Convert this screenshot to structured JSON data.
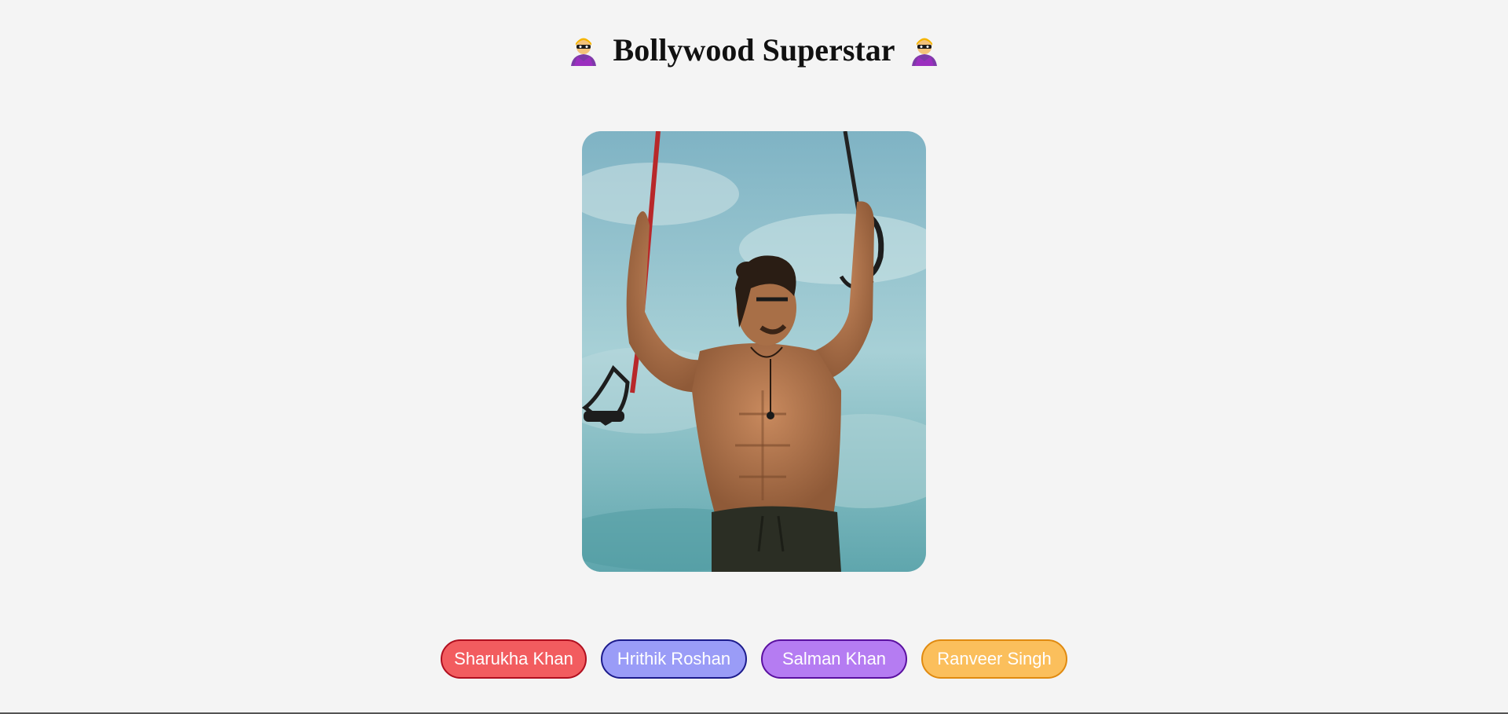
{
  "header": {
    "title": "Bollywood Superstar",
    "icon_left": "superhero-icon",
    "icon_right": "superhero-icon"
  },
  "photo": {
    "subject": "shirtless-man-with-resistance-bands",
    "sky_color": "#8fc3cc",
    "shorts_color": "#2b2e24",
    "band_color": "#b8282a"
  },
  "buttons": [
    {
      "label": "Sharukha Khan",
      "bg": "#f25c5f",
      "border": "#b00f1f"
    },
    {
      "label": "Hrithik Roshan",
      "bg": "#9a9cf7",
      "border": "#1c1b8c"
    },
    {
      "label": "Salman Khan",
      "bg": "#b57cf2",
      "border": "#5a10a0"
    },
    {
      "label": "Ranveer Singh",
      "bg": "#fbbf5c",
      "border": "#e08a10"
    }
  ]
}
